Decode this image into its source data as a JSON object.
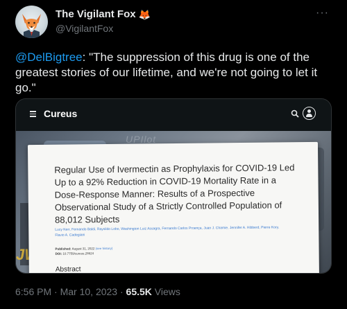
{
  "author": {
    "display_name": "The Vigilant Fox",
    "name_emoji": "🦊",
    "handle": "@VigilantFox"
  },
  "more_label": "···",
  "tweet": {
    "mention": "@DelBigtree",
    "text": ": \"The suppression of this drug is one of the greatest stories of our lifetime, and we're not going to let it go.\""
  },
  "card": {
    "brand": "Cureus",
    "watermark_text": "UPIlot",
    "paper": {
      "title": "Regular Use of Ivermectin as Prophylaxis for COVID-19 Led Up to a 92% Reduction in COVID-19 Mortality Rate in a Dose-Response Manner: Results of a Prospective Observational Study of a Strictly Controlled Population of 88,012 Subjects",
      "authors": "Lucy Kerr, Fernando Baldi, Raysildo Lobo, Washington Luiz Assagra, Fernando Carlos Proença, Juan J. Chamie, Jennifer A. Hibberd, Pierre Kory, Flavio A. Cadegiani",
      "published_label": "Published:",
      "published_value": "August 31, 2022",
      "published_link": "(see history)",
      "doi_label": "DOI:",
      "doi_value": "10.7759/cureus.28624",
      "abstract_heading": "Abstract"
    }
  },
  "meta": {
    "time": "6:56 PM",
    "separator": "·",
    "date": "Mar 10, 2023",
    "views_count": "65.5K",
    "views_label": "Views"
  },
  "colors": {
    "background": "#000000",
    "text": "#e7e9ea",
    "muted": "#71767b",
    "link": "#1d9bf0"
  }
}
